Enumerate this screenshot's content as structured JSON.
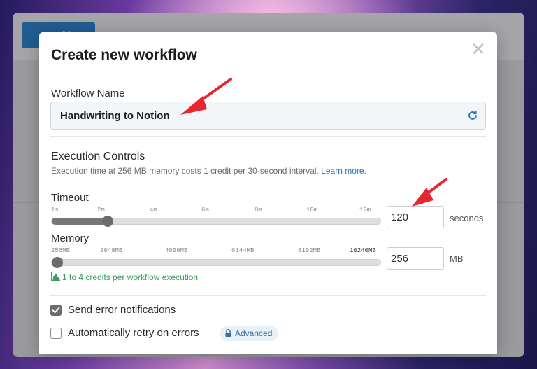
{
  "app": {
    "new_button_label": "+  N"
  },
  "modal": {
    "title": "Create new workflow",
    "close_glyph": "✕"
  },
  "workflow_name": {
    "label": "Workflow Name",
    "value": "Handwriting to Notion"
  },
  "execution": {
    "title": "Execution Controls",
    "description": "Execution time at 256 MB memory costs 1 credit per 30-second interval. ",
    "learn_more": "Learn more."
  },
  "timeout": {
    "label": "Timeout",
    "ticks": [
      "1s",
      "2m",
      "4m",
      "6m",
      "8m",
      "10m",
      "12m"
    ],
    "slider_fraction": 0.17,
    "value": "120",
    "unit": "seconds"
  },
  "memory": {
    "label": "Memory",
    "ticks": [
      "256MB",
      "2048MB",
      "4096MB",
      "6144MB",
      "8192MB",
      "10240MB"
    ],
    "slider_fraction": 0.0,
    "value": "256",
    "unit": "MB"
  },
  "credits_note": "1 to 4 credits per workflow execution",
  "options": {
    "send_errors": {
      "label": "Send error notifications",
      "checked": true
    },
    "auto_retry": {
      "label": "Automatically retry on errors",
      "checked": false,
      "badge": "Advanced"
    }
  },
  "colors": {
    "accent": "#2a72b5",
    "credits": "#3c9c5c",
    "annotation": "#e8262f"
  }
}
